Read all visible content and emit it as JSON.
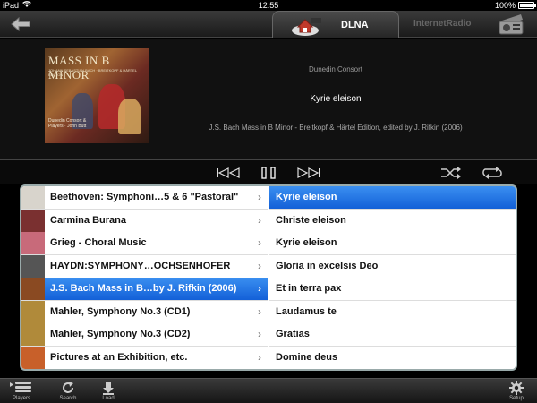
{
  "status_bar": {
    "device": "iPad",
    "time": "12:55",
    "battery": "100%"
  },
  "top_bar": {
    "tabs": [
      {
        "label": "DLNA",
        "active": true,
        "icon": "dlna-house-icon"
      },
      {
        "label": "InternetRadio",
        "active": false,
        "icon": "radio-icon"
      }
    ]
  },
  "now_playing": {
    "artist": "Dunedin Consort",
    "title": "Kyrie eleison",
    "album": "J.S. Bach Mass in B Minor - Breitkopf & Härtel Edition, edited by J. Rifkin (2006)",
    "cover_title": "MASS IN B MINOR",
    "cover_subtitle": "JOHANN SEBASTIAN BACH · BREITKOPF & HÄRTEL EDITION",
    "cover_performer": "Dunedin Consort & Players · John Butt"
  },
  "transport": {
    "buttons": [
      "previous-icon",
      "pause-icon",
      "next-icon",
      "shuffle-icon",
      "repeat-icon"
    ]
  },
  "albums": [
    {
      "label": "Beethoven: Symphoni…5 & 6 \"Pastoral\"",
      "thumb": "#d8d4cc",
      "selected": false
    },
    {
      "label": "Carmina Burana",
      "thumb": "#7a3030",
      "selected": false
    },
    {
      "label": "Grieg - Choral Music",
      "thumb": "#c86a7a",
      "selected": false
    },
    {
      "label": "HAYDN:SYMPHONY…OCHSENHOFER",
      "thumb": "#555555",
      "selected": false
    },
    {
      "label": "J.S. Bach Mass in B…by J. Rifkin (2006)",
      "thumb": "#8a4a22",
      "selected": true
    },
    {
      "label": "Mahler, Symphony No.3 (CD1)",
      "thumb": "#b08a3a",
      "selected": false
    },
    {
      "label": "Mahler, Symphony No.3 (CD2)",
      "thumb": "#b08a3a",
      "selected": false
    },
    {
      "label": "Pictures at an Exhibition, etc.",
      "thumb": "#c8602a",
      "selected": false
    }
  ],
  "tracks": [
    {
      "label": "Kyrie eleison",
      "selected": true
    },
    {
      "label": "Christe eleison",
      "selected": false
    },
    {
      "label": "Kyrie eleison",
      "selected": false
    },
    {
      "label": "Gloria in excelsis Deo",
      "selected": false
    },
    {
      "label": "Et in terra pax",
      "selected": false
    },
    {
      "label": "Laudamus te",
      "selected": false
    },
    {
      "label": "Gratias",
      "selected": false
    },
    {
      "label": "Domine deus",
      "selected": false
    }
  ],
  "bottom_bar": {
    "players": "Players",
    "search": "Search",
    "load": "Load",
    "setup": "Setup"
  }
}
